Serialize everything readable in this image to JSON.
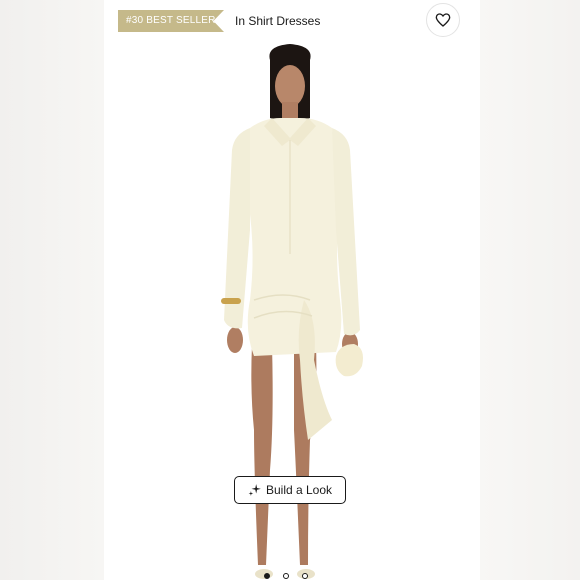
{
  "badge": {
    "label": "#30 BEST SELLER"
  },
  "category": {
    "label": "In Shirt Dresses"
  },
  "wishlist": {
    "icon": "heart-icon"
  },
  "build_look": {
    "label": "Build a Look",
    "icon": "sparkle-icon"
  },
  "carousel": {
    "total": 3,
    "active": 1
  },
  "colors": {
    "badge": "#c5b98a",
    "dress": "#f5f1dd",
    "background": "#ffffff"
  }
}
